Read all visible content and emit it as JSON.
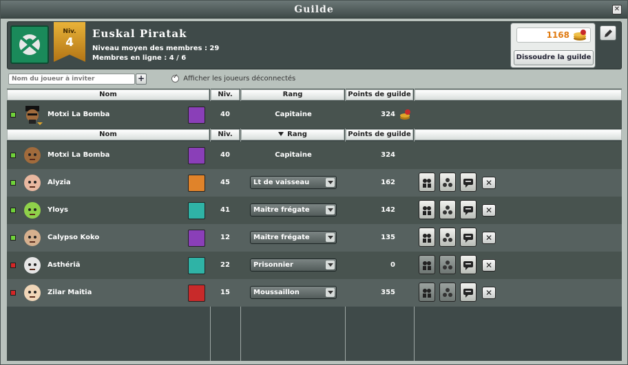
{
  "window": {
    "title": "Guilde"
  },
  "guild": {
    "level_label": "Niv.",
    "level": "4",
    "name": "Euskal Piratak",
    "avg_level_text": "Niveau moyen des membres : 29",
    "online_text": "Membres en ligne : 4 / 6",
    "money": "1168"
  },
  "buttons": {
    "dissolve": "Dissoudre la guilde",
    "invite_add": "+"
  },
  "invite": {
    "placeholder": "Nom du joueur à inviter"
  },
  "filter": {
    "show_offline_label": "Afficher les joueurs déconnectés",
    "checked": true
  },
  "columns": {
    "name": "Nom",
    "level": "Niv.",
    "rank": "Rang",
    "points": "Points de guilde"
  },
  "self_row": {
    "name": "Motxi La Bomba",
    "level": "40",
    "rank": "Capitaine",
    "points": "324",
    "online": true,
    "class_color": "#8a3fb8"
  },
  "members": [
    {
      "name": "Motxi La Bomba",
      "level": "40",
      "rank": "Capitaine",
      "points": "324",
      "online": true,
      "class_color": "#8a3fb8",
      "editable": false
    },
    {
      "name": "Alyzia",
      "level": "45",
      "rank": "Lt de vaisseau",
      "points": "162",
      "online": true,
      "class_color": "#e0832a",
      "editable": true
    },
    {
      "name": "Yloys",
      "level": "41",
      "rank": "Maitre frégate",
      "points": "142",
      "online": true,
      "class_color": "#2fb3a6",
      "editable": true
    },
    {
      "name": "Calypso Koko",
      "level": "12",
      "rank": "Maitre frégate",
      "points": "135",
      "online": true,
      "class_color": "#8a3fb8",
      "editable": true
    },
    {
      "name": "Asthériä",
      "level": "22",
      "rank": "Prisonnier",
      "points": "0",
      "online": false,
      "class_color": "#2fb3a6",
      "editable": true
    },
    {
      "name": "Zilar Maitia",
      "level": "15",
      "rank": "Moussaillon",
      "points": "355",
      "online": false,
      "class_color": "#c82a2a",
      "editable": true
    }
  ],
  "icons": {
    "close": "close-icon",
    "coin": "coin-stack-icon",
    "edit": "pencil-icon",
    "action1": "group-icon",
    "action2": "dots-icon",
    "action3": "chat-icon",
    "kick": "kick-icon"
  }
}
